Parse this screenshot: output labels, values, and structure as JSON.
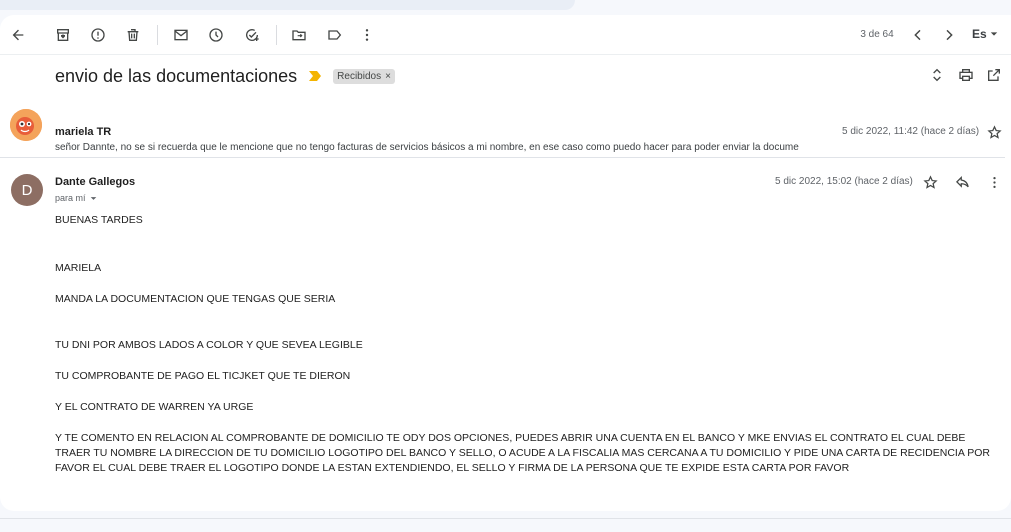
{
  "toolbar": {
    "counter": "3 de 64",
    "language": "Es"
  },
  "thread": {
    "subject": "envio de las documentaciones",
    "label": "Recibidos",
    "label_remove": "×"
  },
  "messages": [
    {
      "sender": "mariela TR",
      "snippet": "señor Dannte, no se si recuerda que le mencione que no tengo facturas de servicios básicos a mi nombre, en ese caso como puedo hacer para poder enviar la docume",
      "date": "5 dic 2022, 11:42 (hace 2 días)"
    },
    {
      "sender": "Dante Gallegos",
      "avatar_letter": "D",
      "recipient": "para mí",
      "date": "5 dic 2022, 15:02 (hace 2 días)",
      "body": [
        "BUENAS TARDES",
        "MARIELA",
        "MANDA LA DOCUMENTACION QUE TENGAS QUE SERIA",
        "TU DNI POR AMBOS LADOS A COLOR Y QUE SEVEA LEGIBLE",
        "TU COMPROBANTE DE PAGO EL TICJKET QUE TE DIERON",
        "Y EL CONTRATO DE WARREN YA URGE",
        "Y TE COMENTO EN RELACION AL COMPROBANTE DE DOMICILIO TE ODY DOS OPCIONES, PUEDES ABRIR UNA CUENTA EN EL BANCO Y MKE ENVIAS EL CONTRATO EL CUAL DEBE TRAER TU NOMBRE LA DIRECCION DE TU DOMICILIO LOGOTIPO DEL BANCO Y SELLO, O ACUDE A LA FISCALIA MAS CERCANA A TU DOMICILIO Y PIDE UNA CARTA DE RECIDENCIA POR FAVOR EL CUAL DEBE TRAER EL LOGOTIPO DONDE LA ESTAN EXTENDIENDO, EL SELLO Y FIRMA DE LA PERSONA QUE TE EXPIDE ESTA CARTA POR FAVOR"
      ]
    }
  ],
  "colors": {
    "background": "#f6f8fc",
    "card": "#ffffff",
    "important_marker": "#f4b400",
    "avatar_dante": "#8d6e63",
    "avatar_mariela": "#f4a35b"
  }
}
